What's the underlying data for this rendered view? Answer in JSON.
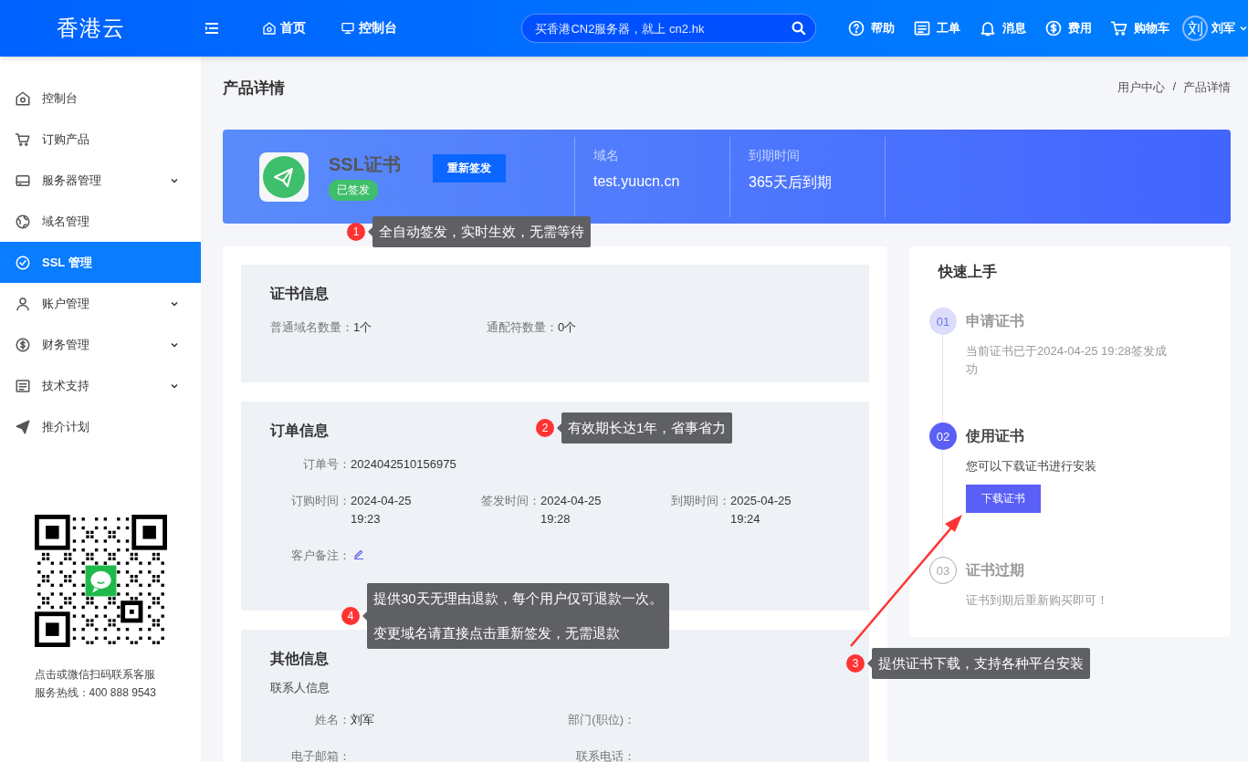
{
  "topbar": {
    "logo": "香港云",
    "nav": [
      {
        "label": "首页"
      },
      {
        "label": "控制台"
      }
    ],
    "search": {
      "placeholder": "买香港CN2服务器，就上 cn2.hk"
    },
    "actions": [
      {
        "label": "帮助"
      },
      {
        "label": "工单"
      },
      {
        "label": "消息"
      },
      {
        "label": "费用"
      },
      {
        "label": "购物车"
      }
    ],
    "user": {
      "avatar": "刘",
      "name": "刘军"
    }
  },
  "sidebar": {
    "items": [
      {
        "label": "控制台",
        "expandable": false,
        "selected": false
      },
      {
        "label": "订购产品",
        "expandable": false,
        "selected": false
      },
      {
        "label": "服务器管理",
        "expandable": true,
        "selected": false
      },
      {
        "label": "域名管理",
        "expandable": false,
        "selected": false
      },
      {
        "label": "SSL 管理",
        "expandable": false,
        "selected": true
      },
      {
        "label": "账户管理",
        "expandable": true,
        "selected": false
      },
      {
        "label": "财务管理",
        "expandable": true,
        "selected": false
      },
      {
        "label": "技术支持",
        "expandable": true,
        "selected": false
      },
      {
        "label": "推介计划",
        "expandable": false,
        "selected": false
      }
    ],
    "qr_caption": "点击或微信扫码联系客服",
    "hotline": "服务热线：400 888 9543"
  },
  "page": {
    "title": "产品详情",
    "breadcrumb": [
      "用户中心",
      "产品详情"
    ],
    "breadcrumb_separator": "/"
  },
  "product": {
    "name": "SSL证书",
    "status": "已签发",
    "action": "重新签发",
    "facts": [
      {
        "label": "域名",
        "value": "test.yuucn.cn"
      },
      {
        "label": "到期时间",
        "value": "365天后到期"
      }
    ]
  },
  "sections": [
    {
      "title": "证书信息",
      "kind": "inline",
      "rows": [
        [
          {
            "label": "普通域名数量：",
            "value": "1个"
          },
          {
            "label": "通配符数量：",
            "value": "0个"
          }
        ]
      ]
    },
    {
      "title": "订单信息",
      "kind": "aligned",
      "rows": [
        [
          {
            "label": "订单号：",
            "value": "2024042510156975"
          }
        ],
        [
          {
            "label": "订购时间：",
            "value": "2024-04-25 19:23"
          },
          {
            "label": "签发时间：",
            "value": "2024-04-25 19:28"
          },
          {
            "label": "到期时间：",
            "value": "2025-04-25 19:24"
          }
        ],
        [
          {
            "label": "客户备注：",
            "editable": true
          }
        ]
      ]
    },
    {
      "title": "其他信息",
      "kind": "aligned",
      "subtitle": "联系人信息",
      "rows": [
        [
          {
            "label": "姓名：",
            "value": "刘军"
          },
          {
            "label": "部门(职位)："
          }
        ],
        [
          {
            "label": "电子邮箱："
          },
          {
            "label": "联系电话："
          }
        ]
      ]
    }
  ],
  "quick_start": {
    "title": "快速上手",
    "steps": [
      {
        "number": "01",
        "title": "申请证书",
        "description": "当前证书已于2024-04-25 19:28签发成功",
        "kind": "done"
      },
      {
        "number": "02",
        "title": "使用证书",
        "description": "您可以下载证书进行安装",
        "button": "下载证书",
        "kind": "current"
      },
      {
        "number": "03",
        "title": "证书过期",
        "description": "证书到期后重新购买即可！",
        "kind": "pending"
      }
    ]
  },
  "callouts": [
    {
      "number": "1",
      "lines": [
        "全自动签发，实时生效，无需等待"
      ]
    },
    {
      "number": "2",
      "lines": [
        "有效期长达1年，省事省力"
      ]
    },
    {
      "number": "3",
      "lines": [
        "提供证书下载，支持各种平台安装"
      ]
    },
    {
      "number": "4",
      "lines": [
        "提供30天无理由退款，每个用户仅可退款一次。",
        "变更域名请直接点击重新签发，无需退款"
      ]
    }
  ]
}
